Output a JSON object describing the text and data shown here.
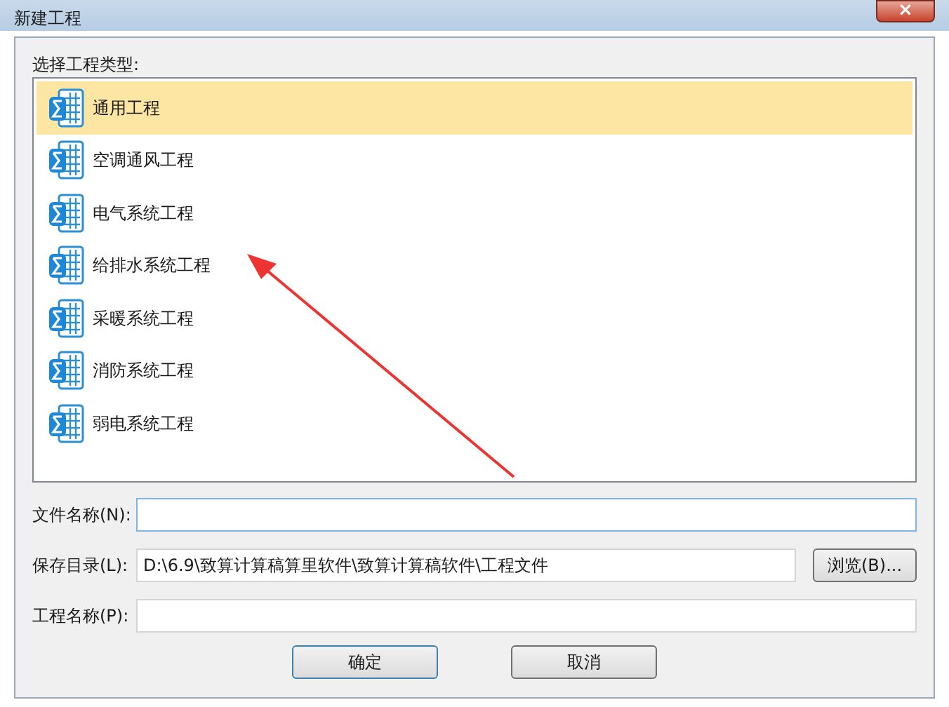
{
  "window": {
    "title": "新建工程",
    "close": "×"
  },
  "type_label": "选择工程类型:",
  "project_types": [
    {
      "label": "通用工程",
      "selected": true
    },
    {
      "label": "空调通风工程",
      "selected": false
    },
    {
      "label": "电气系统工程",
      "selected": false
    },
    {
      "label": "给排水系统工程",
      "selected": false
    },
    {
      "label": "采暖系统工程",
      "selected": false
    },
    {
      "label": "消防系统工程",
      "selected": false
    },
    {
      "label": "弱电系统工程",
      "selected": false
    }
  ],
  "fields": [
    {
      "label": "文件名称(N):",
      "focused": true
    },
    {
      "label": "保存目录(L):",
      "value": "D:\\6.9\\致算计算稿算里软件\\致算计算稿软件\\工程文件",
      "focused": false,
      "button": "浏览(B)..."
    },
    {
      "label": "工程名称(P):",
      "focused": false
    }
  ],
  "buttons": [
    {
      "label": "确定",
      "default": true
    },
    {
      "label": "取消",
      "default": false
    }
  ]
}
